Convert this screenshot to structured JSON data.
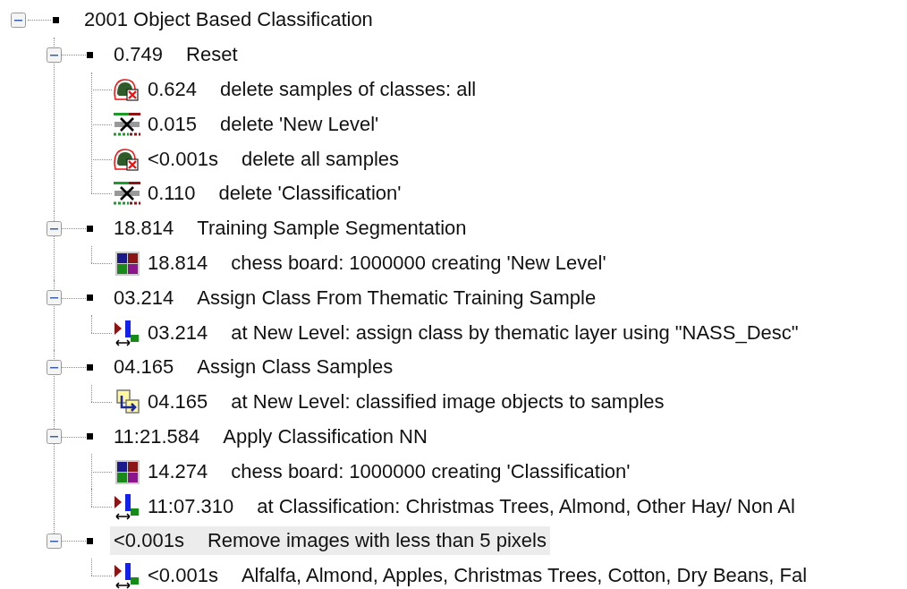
{
  "tree": {
    "root": {
      "label": "2001 Object Based Classification",
      "expanded": true,
      "selected": false,
      "children": [
        {
          "time": "0.749",
          "label": "Reset",
          "expanded": true,
          "selected": false,
          "children": [
            {
              "kind": "delete_samples",
              "time": "0.624",
              "label": "delete samples of classes: all"
            },
            {
              "kind": "delete_level",
              "time": "0.015",
              "label": "delete 'New Level'"
            },
            {
              "kind": "delete_samples",
              "time": "<0.001s",
              "label": "delete all samples"
            },
            {
              "kind": "delete_level",
              "time": "0.110",
              "label": "delete 'Classification'"
            }
          ]
        },
        {
          "time": "18.814",
          "label": "Training Sample Segmentation",
          "expanded": true,
          "selected": false,
          "children": [
            {
              "kind": "chessboard",
              "time": "18.814",
              "label": "chess board: 1000000 creating 'New Level'"
            }
          ]
        },
        {
          "time": "03.214",
          "label": "Assign Class From Thematic Training Sample",
          "expanded": true,
          "selected": false,
          "children": [
            {
              "kind": "assign_class",
              "time": "03.214",
              "label": "at  New Level: assign class by thematic layer using \"NASS_Desc\""
            }
          ]
        },
        {
          "time": "04.165",
          "label": "Assign Class Samples",
          "expanded": true,
          "selected": false,
          "children": [
            {
              "kind": "objects_to_samples",
              "time": "04.165",
              "label": "at  New Level: classified image objects to samples"
            }
          ]
        },
        {
          "time": "11:21.584",
          "label": "Apply Classification NN",
          "expanded": true,
          "selected": false,
          "children": [
            {
              "kind": "chessboard",
              "time": "14.274",
              "label": "chess board: 1000000 creating 'Classification'"
            },
            {
              "kind": "assign_class",
              "time": "11:07.310",
              "label": "at  Classification: Christmas Trees, Almond, Other Hay/ Non Al"
            }
          ]
        },
        {
          "time": "<0.001s",
          "label": "Remove images with less than 5 pixels",
          "expanded": true,
          "selected": true,
          "children": [
            {
              "kind": "assign_class",
              "time": "<0.001s",
              "label": "Alfalfa, Almond, Apples, Christmas Trees, Cotton, Dry Beans, Fal"
            }
          ]
        }
      ]
    }
  }
}
